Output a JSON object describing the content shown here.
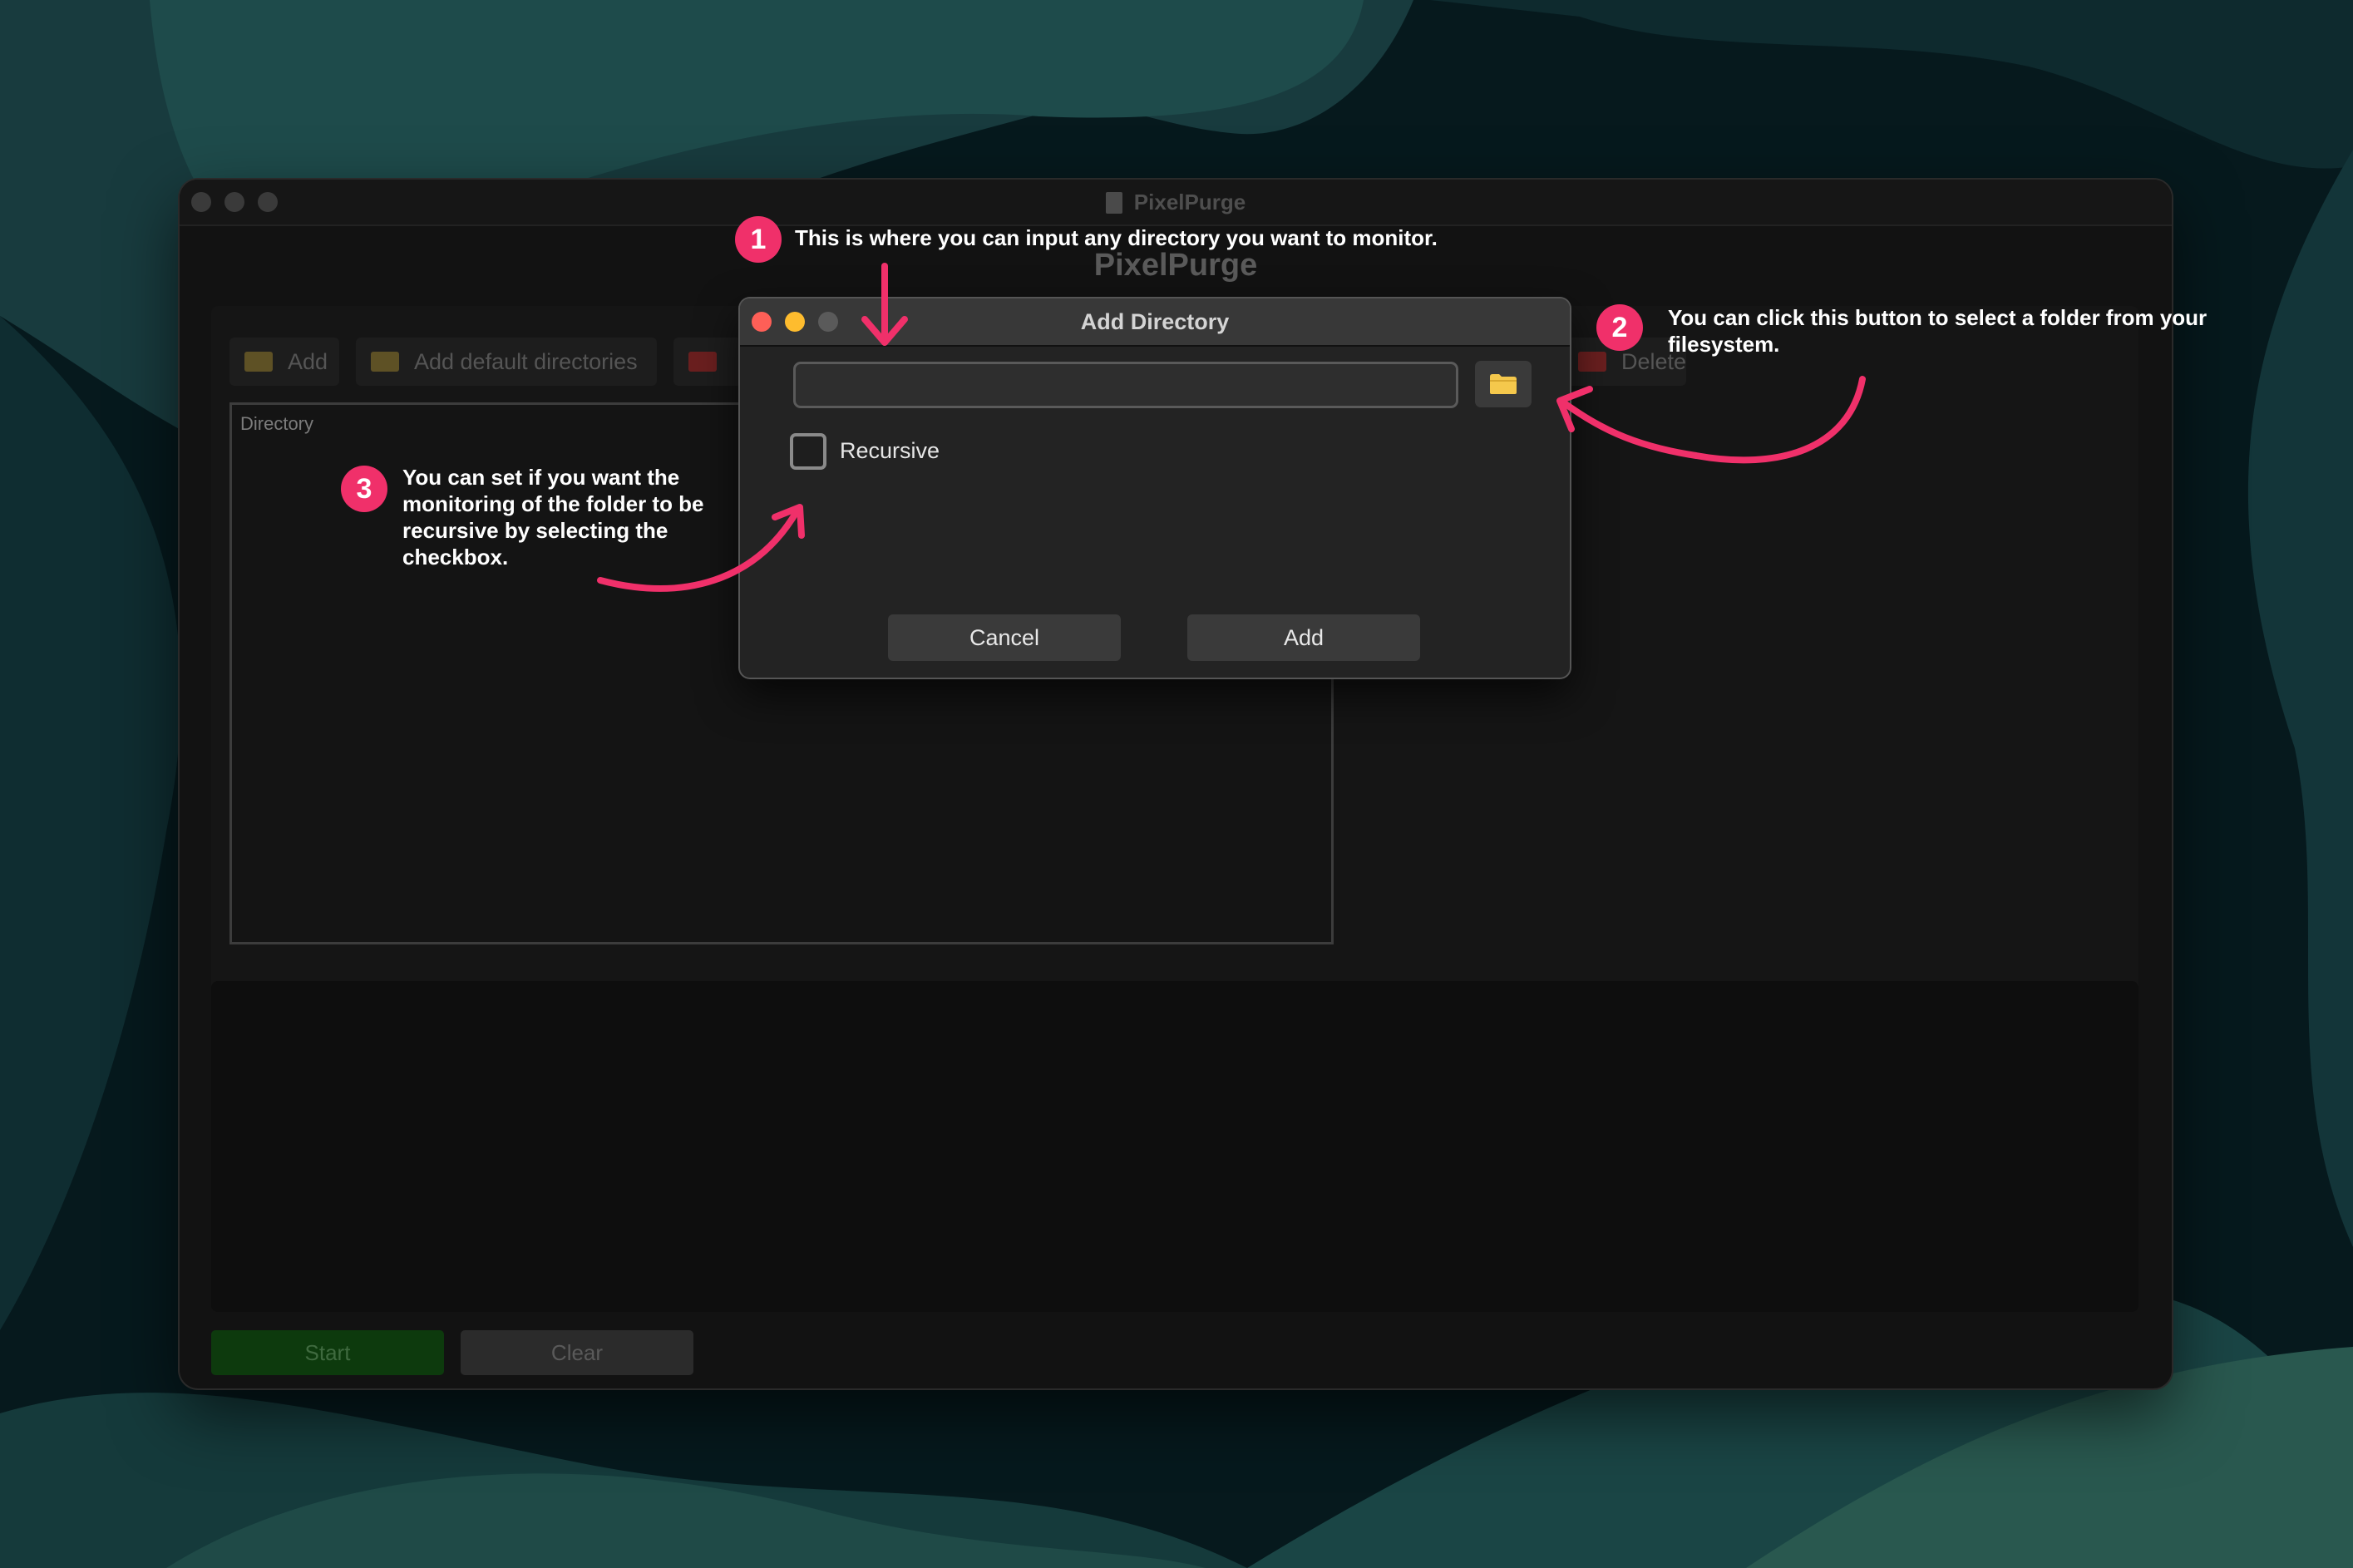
{
  "main_window": {
    "title": "PixelPurge",
    "heading": "PixelPurge",
    "toolbar": {
      "add_label": "Add",
      "add_default_label": "Add default directories",
      "delete_label": "Delete"
    },
    "table": {
      "column_header": "Directory"
    },
    "footer": {
      "start_label": "Start",
      "clear_label": "Clear"
    }
  },
  "dialog": {
    "title": "Add Directory",
    "directory_input": {
      "value": "",
      "placeholder": ""
    },
    "browse_icon": "folder-icon",
    "recursive_label": "Recursive",
    "recursive_checked": false,
    "cancel_label": "Cancel",
    "add_label": "Add"
  },
  "annotations": [
    {
      "number": "1",
      "text": "This is where you can input any directory you want to monitor."
    },
    {
      "number": "2",
      "text": "You can click this button to select a folder from your filesystem."
    },
    {
      "number": "3",
      "text": "You can set if you want the monitoring of the folder to be recursive by selecting the checkbox."
    }
  ],
  "colors": {
    "annotation_accent": "#f0306a",
    "close": "#fe5f57",
    "minimize": "#febc2e",
    "folder_icon": "#f5c84c",
    "start_button": "#0d3a0d",
    "wallpaper_teal": "#1f4f4f"
  }
}
